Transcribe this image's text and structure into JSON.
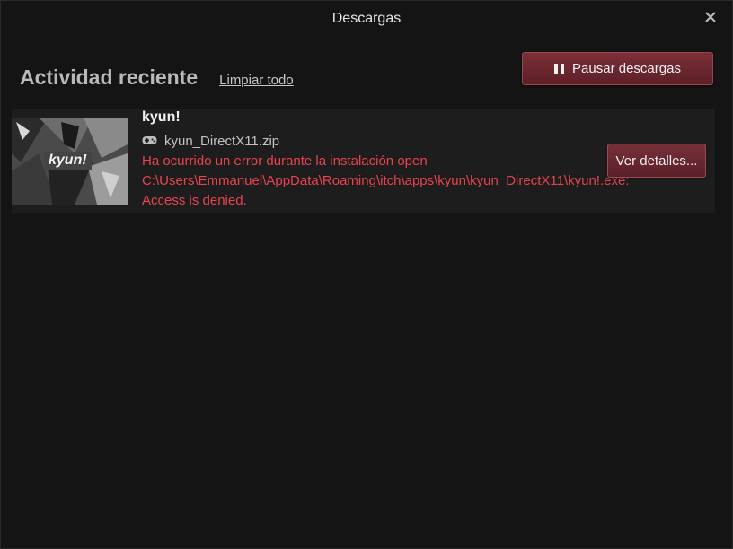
{
  "window": {
    "title": "Descargas",
    "close_icon": "close-icon"
  },
  "header": {
    "section_title": "Actividad reciente",
    "clear_link": "Limpiar todo",
    "pause_button": "Pausar descargas",
    "pause_icon": "pause-icon"
  },
  "downloads": [
    {
      "game_title": "kyun!",
      "thumbnail_label": "kyun!",
      "file_icon": "gamepad-icon",
      "file_name": "kyun_DirectX11.zip",
      "error_line_1": "Ha ocurrido un error durante la instalación open",
      "error_line_2": "C:\\Users\\Emmanuel\\AppData\\Roaming\\itch\\apps\\kyun\\kyun_DirectX11\\kyun!.exe:",
      "error_line_3": "Access is denied.",
      "details_button": "Ver detalles..."
    }
  ],
  "colors": {
    "background": "#141414",
    "item_background": "#1d1d1d",
    "accent_button": "#6b2730",
    "error_text": "#e8434f",
    "title_text": "#e8e8e8",
    "section_title": "#b9b9b9"
  }
}
